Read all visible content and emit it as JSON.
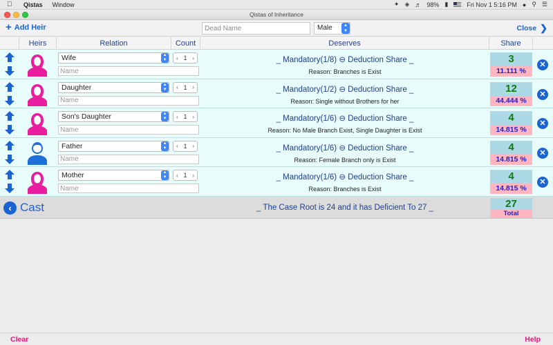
{
  "menubar": {
    "app_name": "Qistas",
    "menu_window": "Window",
    "battery": "98%",
    "clock": "Fri Nov 1  5:16 PM"
  },
  "window": {
    "title": "Qistas of Inheritance"
  },
  "toolbar": {
    "add_heir_label": "Add Heir",
    "dead_name_placeholder": "Dead Name",
    "gender_value": "Male",
    "close_label": "Close"
  },
  "table": {
    "headers": {
      "heirs": "Heirs",
      "relation": "Relation",
      "count": "Count",
      "deserves": "Deserves",
      "share": "Share"
    },
    "name_placeholder": "Name",
    "rows": [
      {
        "relation": "Wife",
        "gender": "female",
        "count": "1",
        "deserves": "_ Mandatory(1/8) ⊖ Deduction Share _",
        "reason": "Reason: Branches is Exist",
        "share": "3",
        "percent": "11.111 %"
      },
      {
        "relation": "Daughter",
        "gender": "female",
        "count": "1",
        "deserves": "_ Mandatory(1/2) ⊖ Deduction Share _",
        "reason": "Reason: Single without Brothers for her",
        "share": "12",
        "percent": "44.444 %"
      },
      {
        "relation": "Son's Daughter",
        "gender": "female",
        "count": "1",
        "deserves": "_ Mandatory(1/6) ⊖ Deduction Share _",
        "reason": "Reason: No Male Branch Exist, Single Daughter is Exist",
        "share": "4",
        "percent": "14.815 %"
      },
      {
        "relation": "Father",
        "gender": "male",
        "count": "1",
        "deserves": "_ Mandatory(1/6) ⊖ Deduction Share _",
        "reason": "Reason: Female Branch only is Exist",
        "share": "4",
        "percent": "14.815 %"
      },
      {
        "relation": "Mother",
        "gender": "female",
        "count": "1",
        "deserves": "_ Mandatory(1/6) ⊖ Deduction Share _",
        "reason": "Reason: Branches is Exist",
        "share": "4",
        "percent": "14.815 %"
      }
    ]
  },
  "summary": {
    "cast_label": "Cast",
    "case_text": "_ The Case Root is 24 and it has Deficient To 27 _",
    "total_value": "27",
    "total_label": "Total"
  },
  "bottom": {
    "clear_label": "Clear",
    "help_label": "Help"
  },
  "colors": {
    "accent": "#1a63d0",
    "female": "#e91e9e",
    "male": "#1e6fd9",
    "share_bg": "#add8e6",
    "percent_bg": "#ffb6c1",
    "row_bg": "#e8fcfc",
    "footer_link": "#e0177a"
  }
}
